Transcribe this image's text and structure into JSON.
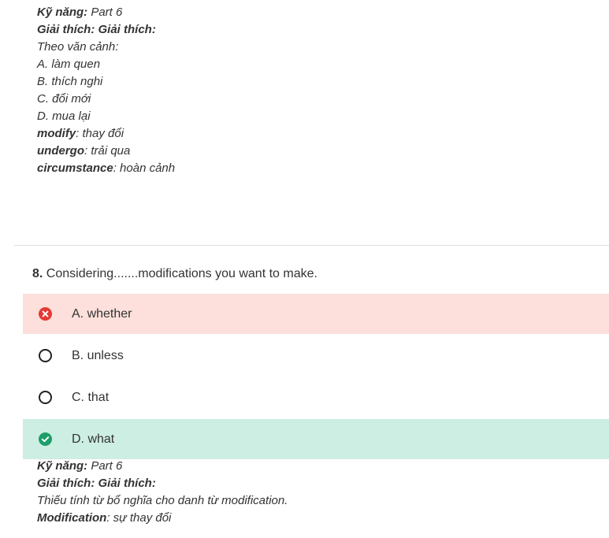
{
  "explanation_top": {
    "skill_label": "Kỹ năng:",
    "skill_value": " Part 6",
    "explain_label": "Giải thích: Giải thích:",
    "lines": [
      "Theo văn cảnh:",
      "A. làm quen",
      "B. thích nghi",
      "C. đổi mới",
      "D. mua lại"
    ],
    "vocab": [
      {
        "word": "modify",
        "meaning": ": thay đổi"
      },
      {
        "word": "undergo",
        "meaning": ": trải qua"
      },
      {
        "word": "circumstance",
        "meaning": ": hoàn cảnh"
      }
    ]
  },
  "question": {
    "number": "8.",
    "text": " Considering.......modifications you want to make.",
    "options": [
      {
        "label": "A. whether",
        "state": "wrong"
      },
      {
        "label": "B. unless",
        "state": "none"
      },
      {
        "label": "C. that",
        "state": "none"
      },
      {
        "label": "D. what",
        "state": "correct"
      }
    ]
  },
  "explanation_bottom": {
    "skill_label": "Kỹ năng:",
    "skill_value": " Part 6",
    "explain_label": "Giải thích: Giải thích:",
    "line": "Thiếu tính từ bổ nghĩa cho danh từ modification.",
    "vocab_word": "Modification",
    "vocab_meaning": ": sự thay đổi"
  },
  "colors": {
    "wrong_bg": "#fde0db",
    "correct_bg": "#cdeee3",
    "wrong_icon": "#e53935",
    "correct_icon": "#1e9e6a"
  },
  "icons": {
    "wrong": "x-circle-icon",
    "correct": "check-circle-icon",
    "unselected": "radio-empty-icon"
  }
}
